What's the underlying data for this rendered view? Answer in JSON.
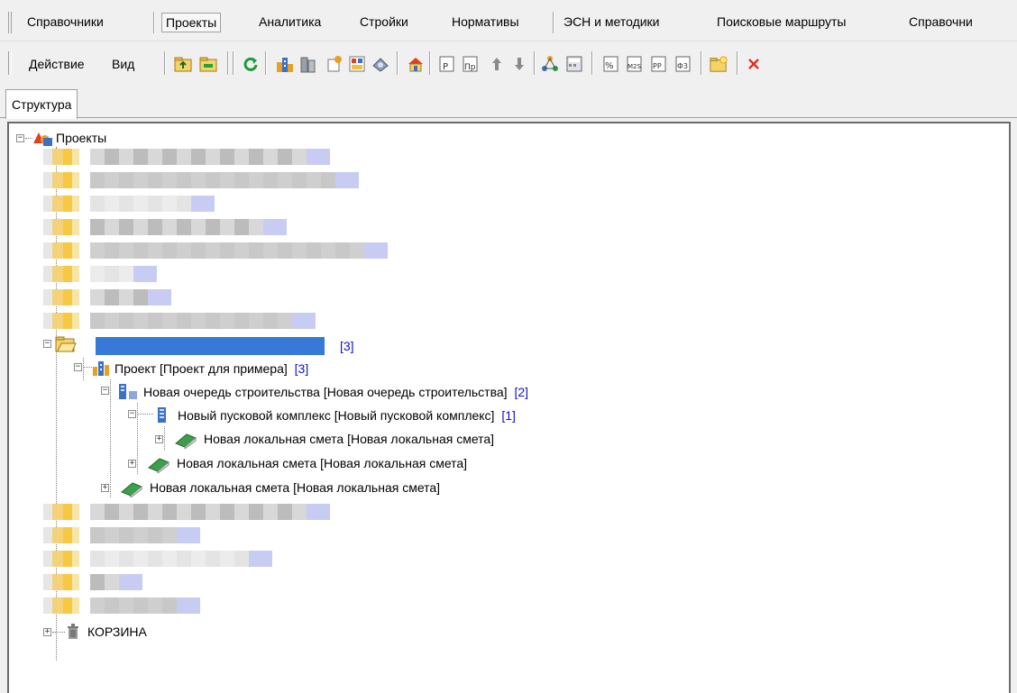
{
  "menu": {
    "items": [
      {
        "label": "Справочники"
      },
      {
        "label": "Проекты"
      },
      {
        "label": "Аналитика"
      },
      {
        "label": "Стройки"
      },
      {
        "label": "Нормативы"
      },
      {
        "label": "ЭСН и методики"
      },
      {
        "label": "Поисковые маршруты"
      },
      {
        "label": "Справочни"
      }
    ]
  },
  "toolbar": {
    "action_label": "Действие",
    "view_label": "Вид",
    "icons": [
      "folder-up-icon",
      "folder-green-icon",
      "refresh-icon",
      "buildings-icon",
      "building-gray-icon",
      "construction-icon",
      "report-icon",
      "stamp-icon",
      "house-icon",
      "p-doc-icon",
      "pr-doc-icon",
      "arrow-up-icon",
      "arrow-down-icon",
      "network-icon",
      "calc-icon",
      "percent-doc-icon",
      "m2s-doc-icon",
      "pp-doc-icon",
      "f3-doc-icon",
      "folder-new-icon",
      "delete-icon"
    ],
    "accent_red": "#e03020",
    "accent_green": "#1a9a3a"
  },
  "tabs": [
    {
      "label": "Структура"
    }
  ],
  "tree": {
    "root_label": "Проекты",
    "selected_count": "[3]",
    "project": {
      "label": "Проект [Проект для примера]",
      "count": "[3]"
    },
    "queue": {
      "label": "Новая очередь строительства [Новая очередь строительства]",
      "count": "[2]"
    },
    "complex": {
      "label": "Новый пусковой комплекс [Новый пусковой комплекс]",
      "count": "[1]"
    },
    "estimate_1": {
      "label": "Новая локальная смета [Новая локальная смета]"
    },
    "estimate_2": {
      "label": "Новая локальная смета [Новая локальная смета]"
    },
    "estimate_3": {
      "label": "Новая локальная смета [Новая локальная смета]"
    },
    "trash_label": "КОРЗИНА",
    "selection_color": "#3779d6",
    "count_color": "#1010d0"
  }
}
